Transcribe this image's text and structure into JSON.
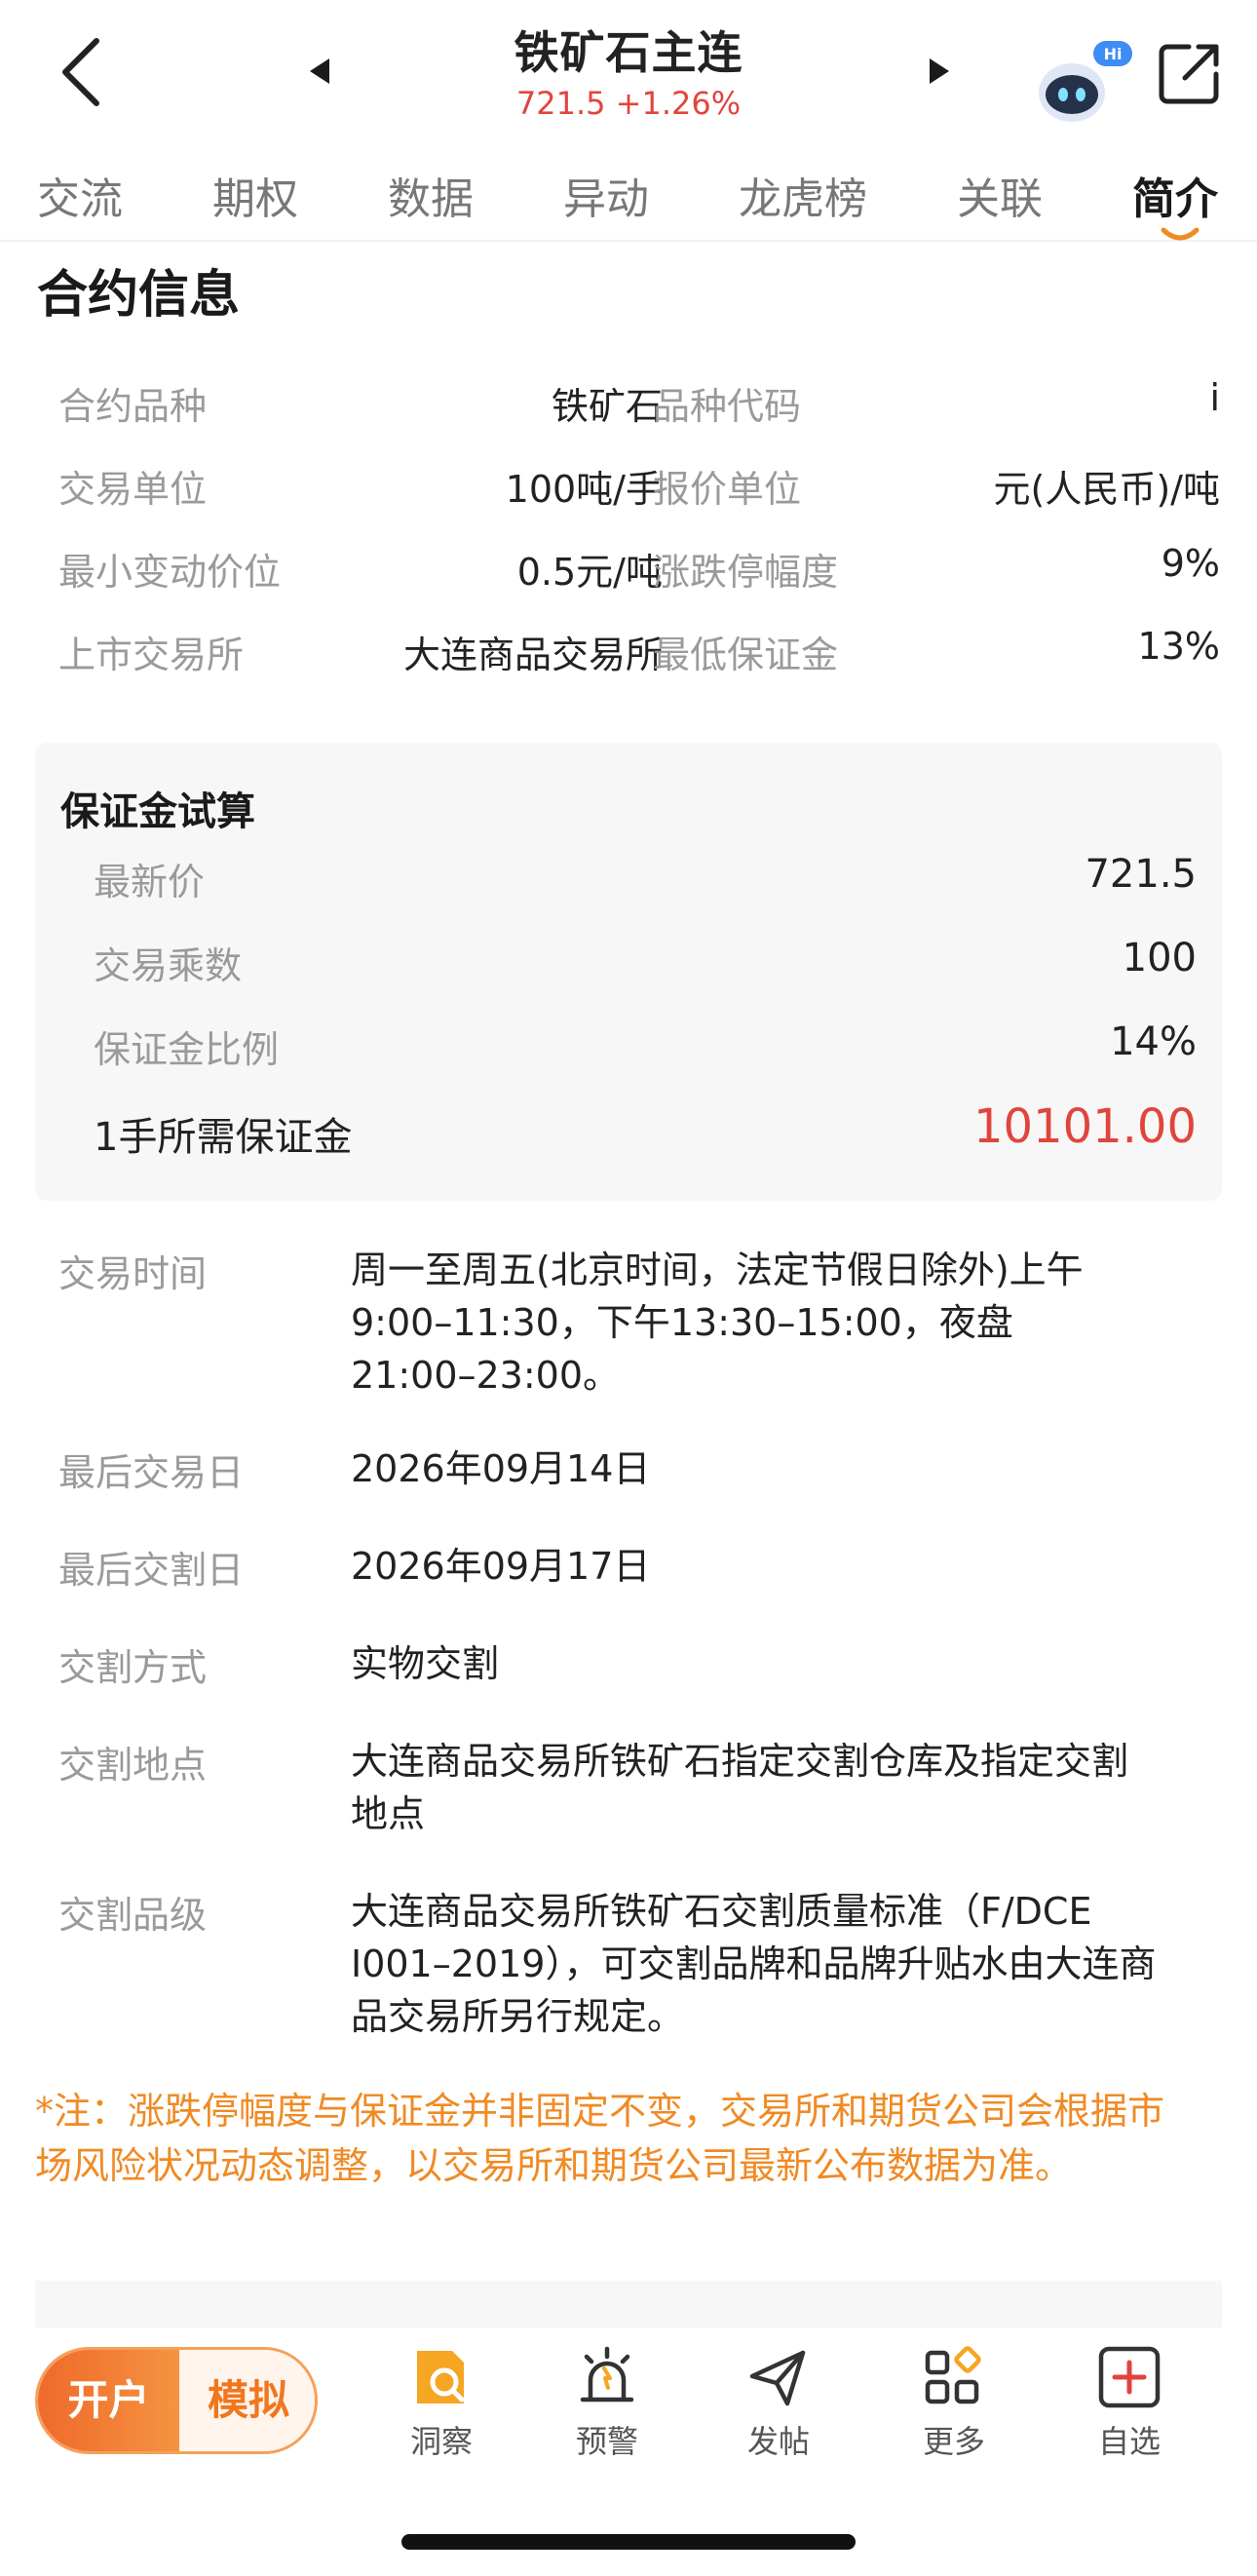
{
  "header": {
    "title": "铁矿石主连",
    "price_change": "721.5 +1.26%",
    "badge": "Hi"
  },
  "tabs": [
    "交流",
    "期权",
    "数据",
    "异动",
    "龙虎榜",
    "关联",
    "简介"
  ],
  "active_tab": "简介",
  "section_title": "合约信息",
  "contract_info": [
    {
      "label1": "合约品种",
      "value1": "铁矿石",
      "label2": "品种代码",
      "value2": "i"
    },
    {
      "label1": "交易单位",
      "value1": "100吨/手",
      "label2": "报价单位",
      "value2": "元(人民币)/吨"
    },
    {
      "label1": "最小变动价位",
      "value1": "0.5元/吨",
      "label2": "涨跌停幅度",
      "value2": "9%"
    },
    {
      "label1": "上市交易所",
      "value1": "大连商品交易所",
      "label2": "最低保证金",
      "value2": "13%"
    }
  ],
  "margin_calc": {
    "title": "保证金试算",
    "rows": [
      {
        "label": "最新价",
        "value": "721.5"
      },
      {
        "label": "交易乘数",
        "value": "100"
      },
      {
        "label": "保证金比例",
        "value": "14%"
      }
    ],
    "total_label": "1手所需保证金",
    "total_value": "10101.00"
  },
  "details": [
    {
      "label": "交易时间",
      "lines": [
        "周一至周五(北京时间，法定节假日除外)上午",
        "9:00–11:30，下午13:30–15:00，夜盘",
        "21:00–23:00。"
      ]
    },
    {
      "label": "最后交易日",
      "lines": [
        "2026年09月14日"
      ]
    },
    {
      "label": "最后交割日",
      "lines": [
        "2026年09月17日"
      ]
    },
    {
      "label": "交割方式",
      "lines": [
        "实物交割"
      ]
    },
    {
      "label": "交割地点",
      "lines": [
        "大连商品交易所铁矿石指定交割仓库及指定交割",
        "地点"
      ]
    },
    {
      "label": "交割品级",
      "lines": [
        "大连商品交易所铁矿石交割质量标准（F/DCE",
        "I001–2019），可交割品牌和品牌升贴水由大连商",
        "品交易所另行规定。"
      ]
    }
  ],
  "note_lines": [
    "*注：涨跌停幅度与保证金并非固定不变，交易所和期货公司会根据市",
    "场风险状况动态调整，以交易所和期货公司最新公布数据为准。"
  ],
  "bottom_bar": {
    "open_account": "开户",
    "simulate": "模拟",
    "items": [
      "洞察",
      "预警",
      "发帖",
      "更多",
      "自选"
    ]
  },
  "colors": {
    "accent_red": "#e0453d",
    "accent_orange": "#f08a24"
  }
}
